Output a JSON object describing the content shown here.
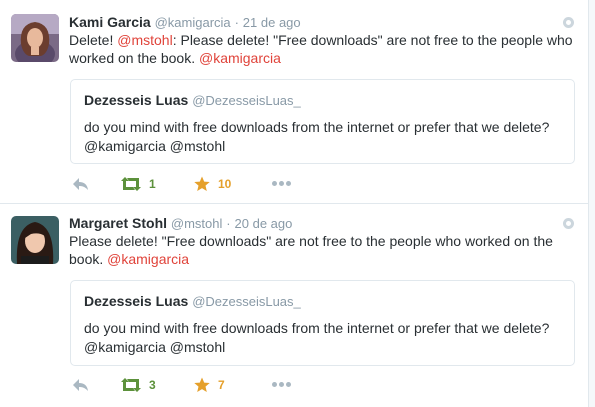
{
  "tweets": [
    {
      "name": "Kami Garcia",
      "handle": "@kamigarcia",
      "dot": "·",
      "time": "21 de ago",
      "text_parts": [
        "Delete! ",
        "@mstohl",
        ": Please delete! \"Free downloads\" are not free to the people who worked on the book. ",
        "@kamigarcia"
      ],
      "quote": {
        "name": "Dezesseis Luas",
        "handle": "@DezesseisLuas_",
        "text": "do you mind with free downloads from the internet or prefer that we delete? @kamigarcia  @mstohl"
      },
      "retweets": "1",
      "favorites": "10"
    },
    {
      "name": "Margaret Stohl",
      "handle": "@mstohl",
      "dot": "·",
      "time": "20 de ago",
      "text_parts": [
        "Please delete! \"Free downloads\" are not free to the people who worked on the book. ",
        "@kamigarcia"
      ],
      "quote": {
        "name": "Dezesseis Luas",
        "handle": "@DezesseisLuas_",
        "text": "do you mind with free downloads from the internet or prefer that we delete? @kamigarcia  @mstohl"
      },
      "retweets": "3",
      "favorites": "7"
    }
  ],
  "colors": {
    "mention": "#e0433a",
    "retweet": "#5c913b",
    "favorite": "#e5a02b",
    "muted": "#8899a6"
  },
  "icons": [
    "reply-icon",
    "retweet-icon",
    "star-icon",
    "more-icon",
    "gear-icon"
  ]
}
